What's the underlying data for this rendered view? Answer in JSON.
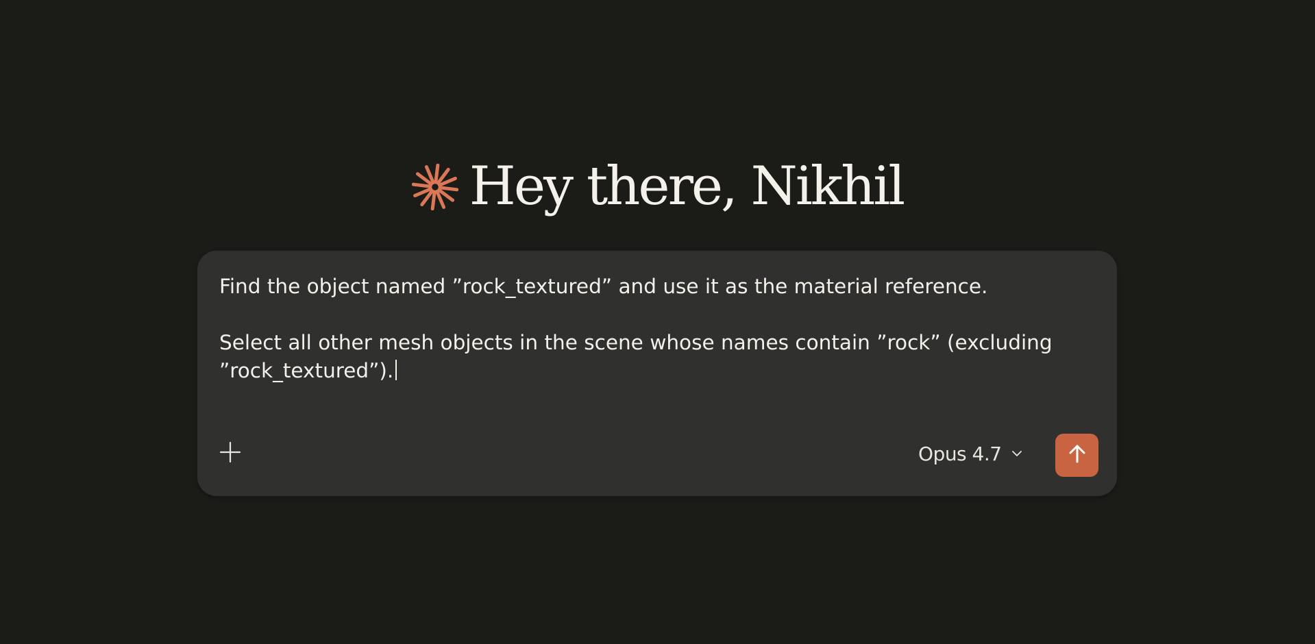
{
  "greeting": {
    "text": "Hey there, Nikhil",
    "icon": "spark-icon",
    "icon_color": "#d97757"
  },
  "composer": {
    "lines": [
      "Find the object named ”rock_textured” and use it as the material reference.",
      "",
      "Select all other mesh objects in the scene whose names contain ”rock” (excluding",
      "”rock_textured”)."
    ],
    "add_icon": "plus-icon",
    "model_label": "Opus 4.7",
    "model_icon": "chevron-down-icon",
    "send_icon": "arrow-up-icon",
    "send_color": "#c96442"
  },
  "colors": {
    "background": "#1b1b18",
    "composer_background": "#30302e",
    "text": "#f4f1ea"
  }
}
